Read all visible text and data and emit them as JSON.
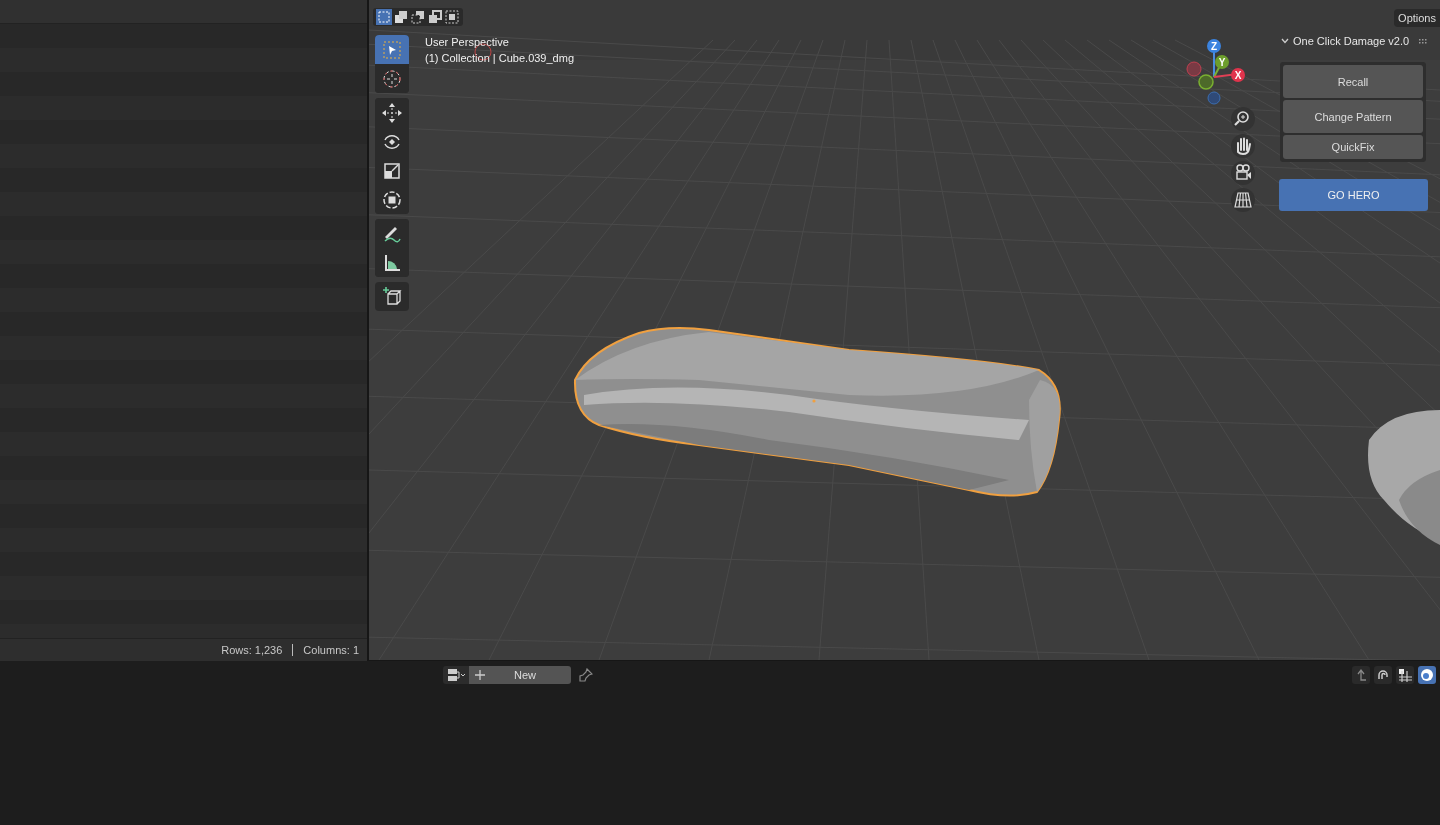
{
  "spreadsheet": {
    "status": {
      "rows": "Rows: 1,236",
      "columns": "Columns: 1"
    }
  },
  "viewport": {
    "view_name": "User Perspective",
    "object_info": "(1) Collection | Cube.039_dmg",
    "select_modes": [
      {
        "kind": "new",
        "selected": true
      },
      {
        "kind": "extend",
        "selected": false
      },
      {
        "kind": "subtract",
        "selected": false
      },
      {
        "kind": "invert",
        "selected": false
      },
      {
        "kind": "intersect",
        "selected": false
      }
    ],
    "tool_groups": [
      [
        {
          "kind": "select",
          "selected": true
        },
        {
          "kind": "cursor",
          "selected": false
        }
      ],
      [
        {
          "kind": "move",
          "selected": false
        },
        {
          "kind": "rotate",
          "selected": false
        },
        {
          "kind": "scale",
          "selected": false
        },
        {
          "kind": "transform",
          "selected": false
        }
      ],
      [
        {
          "kind": "annotate",
          "selected": false
        },
        {
          "kind": "measure",
          "selected": false
        }
      ],
      [
        {
          "kind": "add-cube",
          "selected": false
        }
      ]
    ],
    "options_button": "Options",
    "gizmo": {
      "axes": [
        "Z",
        "Y",
        "X"
      ]
    },
    "nav_buttons": [
      {
        "kind": "zoom"
      },
      {
        "kind": "pan"
      },
      {
        "kind": "camera"
      },
      {
        "kind": "ortho"
      }
    ],
    "addon_panel": {
      "title": "One Click Damage v2.0",
      "expanded": true,
      "buttons": [
        {
          "label": "Recall",
          "kind": "normal"
        },
        {
          "label": "Change Pattern",
          "kind": "normal"
        },
        {
          "label": "QuickFix",
          "kind": "normal"
        },
        {
          "label": "GO HERO",
          "kind": "primary"
        }
      ]
    }
  },
  "bottom_header": {
    "new_button": "New",
    "toggles": [
      {
        "kind": "parent",
        "selected": false
      },
      {
        "kind": "snap",
        "selected": false
      },
      {
        "kind": "transform",
        "selected": false
      },
      {
        "kind": "overlay",
        "selected": true
      }
    ]
  }
}
